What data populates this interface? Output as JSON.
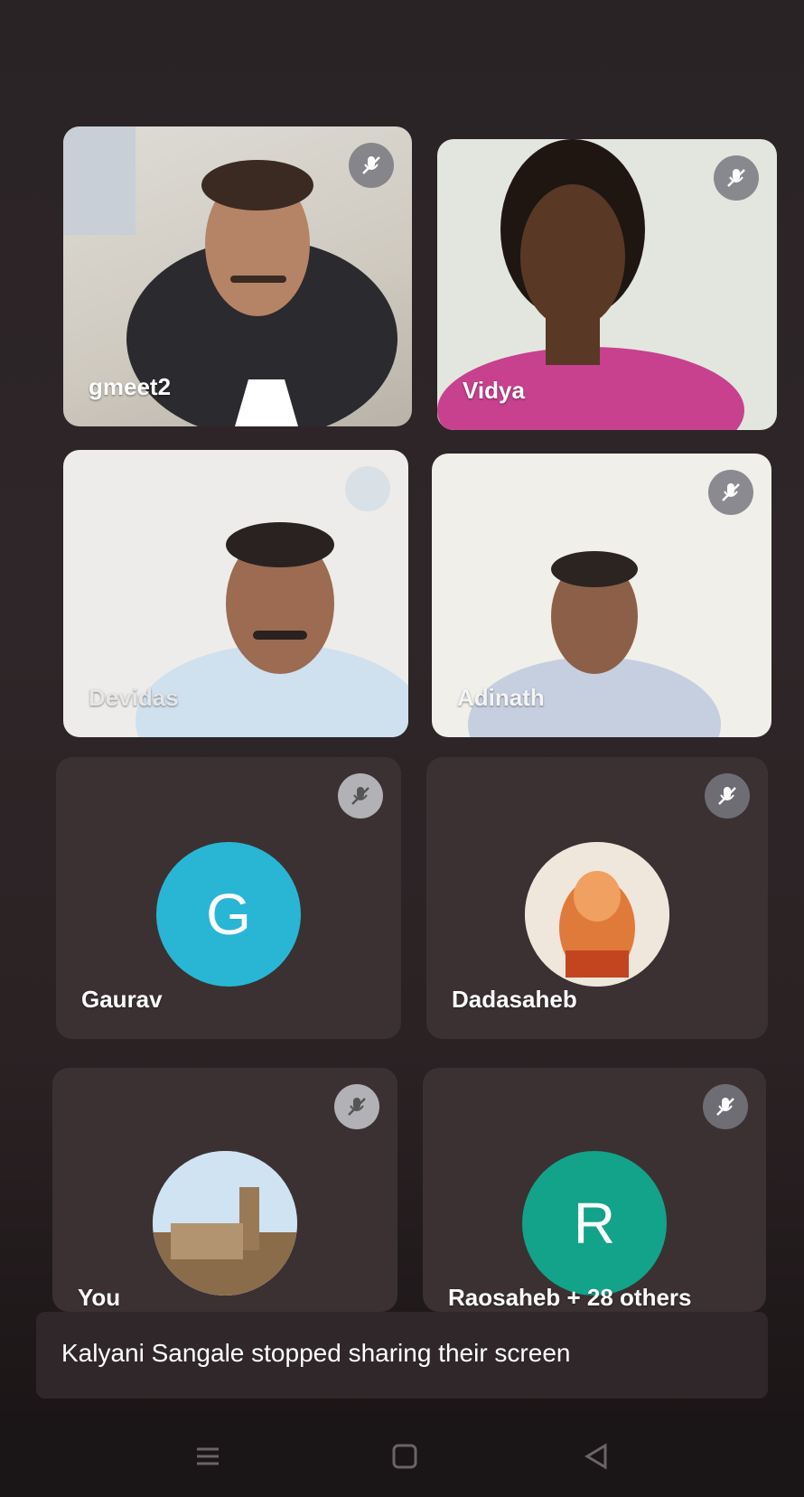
{
  "participants": [
    {
      "name": "gmeet2",
      "muted": true,
      "video": true
    },
    {
      "name": "Vidya",
      "muted": true,
      "video": true
    },
    {
      "name": "Devidas",
      "muted": true,
      "video": true
    },
    {
      "name": "Adinath",
      "muted": true,
      "video": true
    },
    {
      "name": "Gaurav",
      "muted": true,
      "video": false,
      "avatar_letter": "G",
      "avatar_color": "#29b6d4"
    },
    {
      "name": "Dadasaheb",
      "muted": true,
      "video": false,
      "avatar_kind": "photo"
    },
    {
      "name": "You",
      "muted": true,
      "video": false,
      "avatar_kind": "photo"
    },
    {
      "name": "Raosaheb + 28 others",
      "muted": true,
      "video": false,
      "avatar_letter": "R",
      "avatar_color": "#12a38a"
    }
  ],
  "toast": {
    "message": "Kalyani Sangale stopped sharing their screen"
  },
  "colors": {
    "background": "#2e2628",
    "tile_dark": "#3b3133"
  },
  "icons": {
    "mute": "mic-off-icon",
    "nav_menu": "menu-icon",
    "nav_home": "home-icon",
    "nav_back": "back-icon"
  }
}
